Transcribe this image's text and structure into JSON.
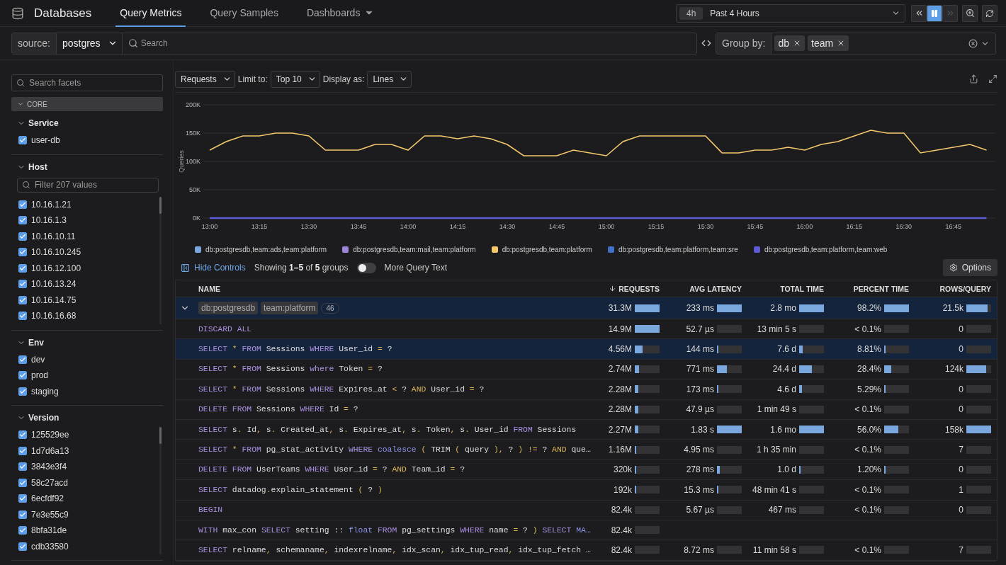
{
  "topbar": {
    "title": "Databases",
    "tabs": [
      {
        "label": "Query Metrics",
        "selected": true,
        "dropdown": false
      },
      {
        "label": "Query Samples",
        "selected": false,
        "dropdown": false
      },
      {
        "label": "Dashboards",
        "selected": false,
        "dropdown": true
      }
    ],
    "timepicker": {
      "badge": "4h",
      "label": "Past 4 Hours",
      "live": true
    }
  },
  "filterbar": {
    "source_label": "source:",
    "source_value": "postgres",
    "search_placeholder": "Search",
    "group_label": "Group by:",
    "group_chips": [
      "db",
      "team"
    ]
  },
  "sidebar": {
    "search_placeholder": "Search facets",
    "section": {
      "label": "CORE",
      "expanded": true
    },
    "facets": [
      {
        "title": "Service",
        "expanded": true,
        "scrollable": false,
        "items": [
          {
            "label": "user-db",
            "checked": true
          }
        ]
      },
      {
        "title": "Host",
        "expanded": true,
        "scrollable": true,
        "filter_placeholder": "Filter 207 values",
        "items": [
          {
            "label": "10.16.1.21",
            "checked": true
          },
          {
            "label": "10.16.1.3",
            "checked": true
          },
          {
            "label": "10.16.10.11",
            "checked": true
          },
          {
            "label": "10.16.10.245",
            "checked": true
          },
          {
            "label": "10.16.12.100",
            "checked": true
          },
          {
            "label": "10.16.13.24",
            "checked": true
          },
          {
            "label": "10.16.14.75",
            "checked": true
          },
          {
            "label": "10.16.16.68",
            "checked": true
          }
        ]
      },
      {
        "title": "Env",
        "expanded": true,
        "scrollable": false,
        "items": [
          {
            "label": "dev",
            "checked": true
          },
          {
            "label": "prod",
            "checked": true
          },
          {
            "label": "staging",
            "checked": true
          }
        ]
      },
      {
        "title": "Version",
        "expanded": true,
        "scrollable": true,
        "items": [
          {
            "label": "125529ee",
            "checked": true
          },
          {
            "label": "1d7d6a13",
            "checked": true
          },
          {
            "label": "3843e3f4",
            "checked": true
          },
          {
            "label": "58c27acd",
            "checked": true
          },
          {
            "label": "6ecfdf92",
            "checked": true
          },
          {
            "label": "7e3e55c9",
            "checked": true
          },
          {
            "label": "8bfa31de",
            "checked": true
          },
          {
            "label": "cdb33580",
            "checked": true
          }
        ]
      }
    ]
  },
  "chart_controls": {
    "metric": "Requests",
    "limit_label": "Limit to:",
    "limit": "Top 10",
    "display_label": "Display as:",
    "display": "Lines"
  },
  "chart_data": {
    "type": "line",
    "ylabel": "Queries",
    "grid": true,
    "categories": [
      "13:00",
      null,
      null,
      "13:15",
      null,
      null,
      "13:30",
      null,
      null,
      "13:45",
      null,
      null,
      "14:00",
      null,
      null,
      "14:15",
      null,
      null,
      "14:30",
      null,
      null,
      "14:45",
      null,
      null,
      "15:00",
      null,
      null,
      "15:15",
      null,
      null,
      "15:30",
      null,
      null,
      "15:45",
      null,
      null,
      "16:00",
      null,
      null,
      "16:15",
      null,
      null,
      "16:30",
      null,
      null,
      "16:45",
      null,
      null
    ],
    "ylim": [
      0,
      200000
    ],
    "yticks": [
      {
        "value": 0,
        "label": "0K"
      },
      {
        "value": 50000,
        "label": "50K"
      },
      {
        "value": 100000,
        "label": "100K"
      },
      {
        "value": 150000,
        "label": "150K"
      },
      {
        "value": 200000,
        "label": "200K"
      }
    ],
    "series": [
      {
        "name": "db:postgresdb,team:ads,team:platform",
        "color": "#7aa7dd",
        "values": [
          null,
          null,
          null,
          null,
          null,
          null,
          null,
          null,
          null,
          null,
          null,
          null,
          null,
          null,
          null,
          null,
          null,
          null,
          null,
          null,
          null,
          null,
          null,
          null,
          null,
          null,
          null,
          null,
          null,
          null,
          null,
          null,
          null,
          null,
          null,
          null,
          null,
          null,
          null,
          null,
          null,
          null,
          null,
          null,
          null,
          null,
          null,
          null
        ]
      },
      {
        "name": "db:postgresdb,team:mail,team:platform",
        "color": "#9b86d8",
        "values": [
          null,
          null,
          null,
          null,
          null,
          null,
          null,
          null,
          null,
          null,
          null,
          null,
          null,
          null,
          null,
          null,
          null,
          null,
          null,
          null,
          null,
          null,
          null,
          null,
          null,
          null,
          null,
          null,
          null,
          null,
          null,
          null,
          null,
          null,
          null,
          null,
          null,
          null,
          null,
          null,
          null,
          null,
          null,
          null,
          null,
          null,
          null,
          null
        ]
      },
      {
        "name": "db:postgresdb,team:platform",
        "color": "#f3c96b",
        "values": [
          120000,
          135000,
          145000,
          145000,
          150000,
          150000,
          145000,
          120000,
          120000,
          120000,
          130000,
          130000,
          120000,
          145000,
          145000,
          140000,
          145000,
          140000,
          130000,
          110000,
          110000,
          110000,
          120000,
          115000,
          110000,
          135000,
          145000,
          145000,
          145000,
          145000,
          145000,
          115000,
          115000,
          120000,
          120000,
          125000,
          120000,
          130000,
          135000,
          145000,
          155000,
          150000,
          150000,
          115000,
          120000,
          125000,
          130000,
          120000
        ]
      },
      {
        "name": "db:postgresdb,team:platform,team:sre",
        "color": "#3f72c7",
        "values": [
          null,
          null,
          null,
          null,
          null,
          null,
          null,
          null,
          null,
          null,
          null,
          null,
          null,
          null,
          null,
          null,
          null,
          null,
          null,
          null,
          null,
          null,
          null,
          null,
          null,
          null,
          null,
          null,
          null,
          null,
          null,
          null,
          null,
          null,
          null,
          null,
          null,
          null,
          null,
          null,
          null,
          null,
          null,
          null,
          null,
          null,
          null,
          null
        ]
      },
      {
        "name": "db:postgresdb,team:platform,team:web",
        "color": "#5b5bd6",
        "values": [
          0,
          0,
          0,
          0,
          0,
          0,
          0,
          0,
          0,
          0,
          0,
          0,
          0,
          0,
          0,
          0,
          0,
          0,
          0,
          0,
          0,
          0,
          0,
          0,
          0,
          0,
          0,
          0,
          0,
          0,
          0,
          0,
          0,
          0,
          0,
          0,
          0,
          0,
          0,
          0,
          0,
          0,
          0,
          0,
          0,
          0,
          0,
          0
        ]
      }
    ]
  },
  "table_controls": {
    "hide_controls": "Hide Controls",
    "showing": "Showing **1–5** of **5** groups",
    "more_query_text": {
      "label": "More Query Text",
      "on": false
    },
    "options": "Options"
  },
  "table": {
    "name_column": "NAME",
    "columns": [
      {
        "label": "REQUESTS",
        "sorted": true
      },
      {
        "label": "AVG LATENCY",
        "sorted": false
      },
      {
        "label": "TOTAL TIME",
        "sorted": false
      },
      {
        "label": "PERCENT TIME",
        "sorted": false
      },
      {
        "label": "ROWS/QUERY",
        "sorted": false
      }
    ],
    "rows": [
      {
        "kind": "group",
        "expanded": true,
        "highlighted": true,
        "tags": [
          "db:postgresdb",
          "team:platform"
        ],
        "count": "46",
        "cells": [
          {
            "value": "31.3M",
            "level": 1
          },
          {
            "value": "233 ms",
            "level": 1
          },
          {
            "value": "2.8 mo",
            "level": 1
          },
          {
            "value": "98.2%",
            "level": 1
          },
          {
            "value": "21.5k",
            "level": 0.85
          }
        ]
      },
      {
        "kind": "query",
        "highlighted": false,
        "query": [
          {
            "kind": "kw",
            "text": "DISCARD ALL"
          }
        ],
        "cells": [
          {
            "value": "14.9M",
            "level": 1
          },
          {
            "value": "52.7 µs",
            "level": 0
          },
          {
            "value": "13 min 5 s",
            "level": 0
          },
          {
            "value": "< 0.1%",
            "level": 0
          },
          {
            "value": "0",
            "level": 0
          }
        ]
      },
      {
        "kind": "query",
        "highlighted": true,
        "query": [
          {
            "kind": "kw",
            "text": "SELECT "
          },
          {
            "kind": "op",
            "text": "* "
          },
          {
            "kind": "kw",
            "text": "FROM "
          },
          {
            "kind": "id",
            "text": "Sessions "
          },
          {
            "kind": "kw",
            "text": "WHERE "
          },
          {
            "kind": "id",
            "text": "User_id "
          },
          {
            "kind": "op",
            "text": "= "
          },
          {
            "kind": "id",
            "text": "?"
          }
        ],
        "cells": [
          {
            "value": "4.56M",
            "level": 0.3
          },
          {
            "value": "144 ms",
            "level": 0.05
          },
          {
            "value": "7.6 d",
            "level": 0.15
          },
          {
            "value": "8.81%",
            "level": 0.06
          },
          {
            "value": "0",
            "level": 0
          }
        ]
      },
      {
        "kind": "query",
        "highlighted": false,
        "query": [
          {
            "kind": "kw",
            "text": "SELECT "
          },
          {
            "kind": "op",
            "text": "* "
          },
          {
            "kind": "kw",
            "text": "FROM "
          },
          {
            "kind": "id",
            "text": "Sessions "
          },
          {
            "kind": "kw",
            "text": "where "
          },
          {
            "kind": "id",
            "text": "Token "
          },
          {
            "kind": "op",
            "text": "= "
          },
          {
            "kind": "id",
            "text": "?"
          }
        ],
        "cells": [
          {
            "value": "2.74M",
            "level": 0.18
          },
          {
            "value": "771 ms",
            "level": 0.4
          },
          {
            "value": "24.4 d",
            "level": 0.5
          },
          {
            "value": "28.4%",
            "level": 0.28
          },
          {
            "value": "124k",
            "level": 0.8
          }
        ]
      },
      {
        "kind": "query",
        "highlighted": false,
        "query": [
          {
            "kind": "kw",
            "text": "SELECT "
          },
          {
            "kind": "op",
            "text": "* "
          },
          {
            "kind": "kw",
            "text": "FROM "
          },
          {
            "kind": "id",
            "text": "Sessions "
          },
          {
            "kind": "kw",
            "text": "WHERE "
          },
          {
            "kind": "id",
            "text": "Expires_at "
          },
          {
            "kind": "op",
            "text": "< "
          },
          {
            "kind": "id",
            "text": "? "
          },
          {
            "kind": "op",
            "text": "AND "
          },
          {
            "kind": "id",
            "text": "User_id "
          },
          {
            "kind": "op",
            "text": "= "
          },
          {
            "kind": "id",
            "text": "?"
          }
        ],
        "cells": [
          {
            "value": "2.28M",
            "level": 0.15
          },
          {
            "value": "173 ms",
            "level": 0.07
          },
          {
            "value": "4.6 d",
            "level": 0.1
          },
          {
            "value": "5.29%",
            "level": 0.05
          },
          {
            "value": "0",
            "level": 0
          }
        ]
      },
      {
        "kind": "query",
        "highlighted": false,
        "query": [
          {
            "kind": "kw",
            "text": "DELETE FROM "
          },
          {
            "kind": "id",
            "text": "Sessions "
          },
          {
            "kind": "kw",
            "text": "WHERE "
          },
          {
            "kind": "id",
            "text": "Id "
          },
          {
            "kind": "op",
            "text": "= "
          },
          {
            "kind": "id",
            "text": "?"
          }
        ],
        "cells": [
          {
            "value": "2.28M",
            "level": 0.15
          },
          {
            "value": "47.9 µs",
            "level": 0
          },
          {
            "value": "1 min 49 s",
            "level": 0
          },
          {
            "value": "< 0.1%",
            "level": 0
          },
          {
            "value": "0",
            "level": 0
          }
        ]
      },
      {
        "kind": "query",
        "highlighted": false,
        "query": [
          {
            "kind": "kw",
            "text": "SELECT "
          },
          {
            "kind": "id",
            "text": "s"
          },
          {
            "kind": "op",
            "text": ". "
          },
          {
            "kind": "id",
            "text": "Id"
          },
          {
            "kind": "op",
            "text": ", "
          },
          {
            "kind": "id",
            "text": "s"
          },
          {
            "kind": "op",
            "text": ". "
          },
          {
            "kind": "id",
            "text": "Created_at"
          },
          {
            "kind": "op",
            "text": ", "
          },
          {
            "kind": "id",
            "text": "s"
          },
          {
            "kind": "op",
            "text": ". "
          },
          {
            "kind": "id",
            "text": "Expires_at"
          },
          {
            "kind": "op",
            "text": ", "
          },
          {
            "kind": "id",
            "text": "s"
          },
          {
            "kind": "op",
            "text": ". "
          },
          {
            "kind": "id",
            "text": "Token"
          },
          {
            "kind": "op",
            "text": ", "
          },
          {
            "kind": "id",
            "text": "s"
          },
          {
            "kind": "op",
            "text": ". "
          },
          {
            "kind": "id",
            "text": "User_id "
          },
          {
            "kind": "kw",
            "text": "FROM "
          },
          {
            "kind": "id",
            "text": "Sessions"
          }
        ],
        "cells": [
          {
            "value": "2.27M",
            "level": 0.15
          },
          {
            "value": "1.83 s",
            "level": 1
          },
          {
            "value": "1.6 mo",
            "level": 1
          },
          {
            "value": "56.0%",
            "level": 0.56
          },
          {
            "value": "158k",
            "level": 1
          }
        ]
      },
      {
        "kind": "query",
        "highlighted": false,
        "query": [
          {
            "kind": "kw",
            "text": "SELECT "
          },
          {
            "kind": "op",
            "text": "* "
          },
          {
            "kind": "kw",
            "text": "FROM "
          },
          {
            "kind": "id",
            "text": "pg_stat_activity "
          },
          {
            "kind": "kw",
            "text": "WHERE "
          },
          {
            "kind": "fn",
            "text": "coalesce "
          },
          {
            "kind": "op",
            "text": "( "
          },
          {
            "kind": "id",
            "text": "TRIM "
          },
          {
            "kind": "op",
            "text": "( "
          },
          {
            "kind": "id",
            "text": "query "
          },
          {
            "kind": "op",
            "text": "), "
          },
          {
            "kind": "id",
            "text": "? "
          },
          {
            "kind": "op",
            "text": ") != "
          },
          {
            "kind": "id",
            "text": "? "
          },
          {
            "kind": "op",
            "text": "AND "
          },
          {
            "kind": "id",
            "text": "que…"
          }
        ],
        "cells": [
          {
            "value": "1.16M",
            "level": 0.07
          },
          {
            "value": "4.95 ms",
            "level": 0
          },
          {
            "value": "1 h 35 min",
            "level": 0
          },
          {
            "value": "< 0.1%",
            "level": 0
          },
          {
            "value": "7",
            "level": 0
          }
        ]
      },
      {
        "kind": "query",
        "highlighted": false,
        "query": [
          {
            "kind": "kw",
            "text": "DELETE FROM "
          },
          {
            "kind": "id",
            "text": "UserTeams "
          },
          {
            "kind": "kw",
            "text": "WHERE "
          },
          {
            "kind": "id",
            "text": "User_id "
          },
          {
            "kind": "op",
            "text": "= "
          },
          {
            "kind": "id",
            "text": "? "
          },
          {
            "kind": "op",
            "text": "AND "
          },
          {
            "kind": "id",
            "text": "Team_id "
          },
          {
            "kind": "op",
            "text": "= "
          },
          {
            "kind": "id",
            "text": "?"
          }
        ],
        "cells": [
          {
            "value": "320k",
            "level": 0.02
          },
          {
            "value": "278 ms",
            "level": 0.12
          },
          {
            "value": "1.0 d",
            "level": 0.03
          },
          {
            "value": "1.20%",
            "level": 0.02
          },
          {
            "value": "0",
            "level": 0
          }
        ]
      },
      {
        "kind": "query",
        "highlighted": false,
        "query": [
          {
            "kind": "kw",
            "text": "SELECT "
          },
          {
            "kind": "id",
            "text": "datadog"
          },
          {
            "kind": "op",
            "text": "."
          },
          {
            "kind": "id",
            "text": "explain_statement "
          },
          {
            "kind": "op",
            "text": "( "
          },
          {
            "kind": "id",
            "text": "? "
          },
          {
            "kind": "op",
            "text": ")"
          }
        ],
        "cells": [
          {
            "value": "192k",
            "level": 0.01
          },
          {
            "value": "15.3 ms",
            "level": 0.01
          },
          {
            "value": "48 min 41 s",
            "level": 0
          },
          {
            "value": "< 0.1%",
            "level": 0
          },
          {
            "value": "1",
            "level": 0
          }
        ]
      },
      {
        "kind": "query",
        "highlighted": false,
        "query": [
          {
            "kind": "kw",
            "text": "BEGIN"
          }
        ],
        "cells": [
          {
            "value": "82.4k",
            "level": 0
          },
          {
            "value": "5.67 µs",
            "level": 0
          },
          {
            "value": "467 ms",
            "level": 0
          },
          {
            "value": "< 0.1%",
            "level": 0
          },
          {
            "value": "0",
            "level": 0
          }
        ]
      },
      {
        "kind": "query",
        "highlighted": false,
        "query": [
          {
            "kind": "kw",
            "text": "WITH "
          },
          {
            "kind": "id",
            "text": "max_con "
          },
          {
            "kind": "kw",
            "text": "SELECT "
          },
          {
            "kind": "id",
            "text": "setting :: "
          },
          {
            "kind": "fn",
            "text": "float "
          },
          {
            "kind": "kw",
            "text": "FROM "
          },
          {
            "kind": "id",
            "text": "pg_settings "
          },
          {
            "kind": "kw",
            "text": "WHERE "
          },
          {
            "kind": "id",
            "text": "name "
          },
          {
            "kind": "op",
            "text": "= "
          },
          {
            "kind": "id",
            "text": "? "
          },
          {
            "kind": "op",
            "text": ") "
          },
          {
            "kind": "kw",
            "text": "SELECT "
          },
          {
            "kind": "fn",
            "text": "MA…"
          }
        ],
        "cells": [
          {
            "value": "82.4k",
            "level": 0
          }
        ]
      },
      {
        "kind": "query",
        "highlighted": false,
        "query": [
          {
            "kind": "kw",
            "text": "SELECT "
          },
          {
            "kind": "id",
            "text": "relname"
          },
          {
            "kind": "op",
            "text": ", "
          },
          {
            "kind": "id",
            "text": "schemaname"
          },
          {
            "kind": "op",
            "text": ", "
          },
          {
            "kind": "id",
            "text": "indexrelname"
          },
          {
            "kind": "op",
            "text": ", "
          },
          {
            "kind": "id",
            "text": "idx_scan"
          },
          {
            "kind": "op",
            "text": ", "
          },
          {
            "kind": "id",
            "text": "idx_tup_read"
          },
          {
            "kind": "op",
            "text": ", "
          },
          {
            "kind": "id",
            "text": "idx_tup_fetch …"
          }
        ],
        "cells": [
          {
            "value": "82.4k",
            "level": 0
          },
          {
            "value": "8.72 ms",
            "level": 0
          },
          {
            "value": "11 min 58 s",
            "level": 0
          },
          {
            "value": "< 0.1%",
            "level": 0
          },
          {
            "value": "7",
            "level": 0
          }
        ]
      }
    ]
  }
}
